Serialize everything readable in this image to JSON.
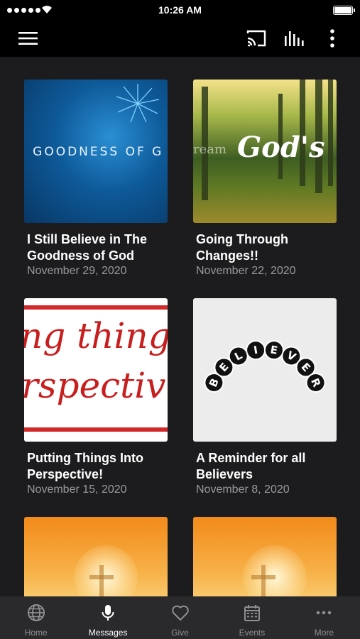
{
  "status_bar": {
    "time": "10:26 AM"
  },
  "app_bar": {
    "menu_icon": "menu-icon",
    "cast_icon": "cast-icon",
    "audio_icon": "audio-bars-icon",
    "more_icon": "more-vert-icon"
  },
  "messages": [
    {
      "title": "I Still Believe in The Goodness of God",
      "date": "November 29, 2020",
      "thumb_text": "E GOODNESS OF G"
    },
    {
      "title": "Going Through Changes!!",
      "date": "November 22, 2020",
      "thumb_text": "God's",
      "thumb_text_faded": "ream"
    },
    {
      "title": "Putting Things Into Perspective!",
      "date": "November 15, 2020",
      "thumb_text": "ng thing",
      "thumb_text_2": "rspectiv"
    },
    {
      "title": "A Reminder for all Believers",
      "date": "November 8, 2020",
      "thumb_text": "BELIEVER"
    },
    {
      "title": "",
      "date": ""
    },
    {
      "title": "",
      "date": ""
    }
  ],
  "tabs": [
    {
      "label": "Home",
      "icon": "globe-icon",
      "active": false
    },
    {
      "label": "Messages",
      "icon": "microphone-icon",
      "active": true
    },
    {
      "label": "Give",
      "icon": "heart-icon",
      "active": false
    },
    {
      "label": "Events",
      "icon": "calendar-icon",
      "active": false
    },
    {
      "label": "More",
      "icon": "more-horiz-icon",
      "active": false
    }
  ],
  "colors": {
    "background": "#1c1c1e",
    "bar": "#000000",
    "tab_bar": "#2a2a2c",
    "date_text": "#9a9a9e",
    "inactive_tab": "#8e8e93"
  }
}
